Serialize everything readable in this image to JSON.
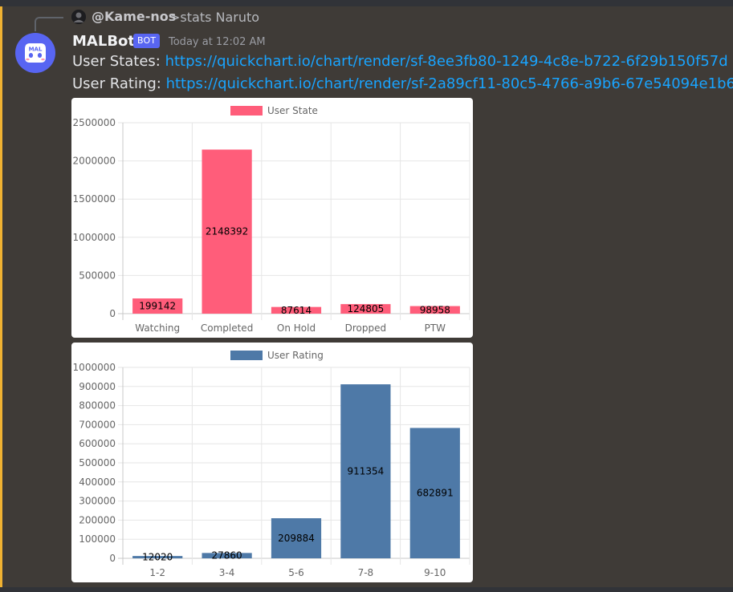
{
  "reply": {
    "author": "@Kame-nos",
    "content": ">stats Naruto"
  },
  "message": {
    "author": "MALBot",
    "badge": "BOT",
    "avatar_text": "MAL",
    "timestamp": "Today at 12:02 AM",
    "line1_label": "User States: ",
    "line1_link": "https://quickchart.io/chart/render/sf-8ee3fb80-1249-4c8e-b722-6f29b150f57d",
    "line2_label": "User Rating: ",
    "line2_link": "https://quickchart.io/chart/render/sf-2a89cf11-80c5-4766-a9b6-67e54094e1b6"
  },
  "colors": {
    "background": "#3f3b37",
    "link": "#19a4ff",
    "badge": "#5865f2",
    "avatar": "#5865f2",
    "accent_bar": "#f0b232",
    "series_state": "#ff5d7a",
    "series_rating": "#4e79a7"
  },
  "chart_data": [
    {
      "type": "bar",
      "legend": "User State",
      "legend_position": "top",
      "categories": [
        "Watching",
        "Completed",
        "On Hold",
        "Dropped",
        "PTW"
      ],
      "values": [
        199142,
        2148392,
        87614,
        124805,
        98958
      ],
      "ylim": [
        0,
        2500000
      ],
      "yticks": [
        0,
        500000,
        1000000,
        1500000,
        2000000,
        2500000
      ],
      "grid": true,
      "color": "#ff5d7a"
    },
    {
      "type": "bar",
      "legend": "User Rating",
      "legend_position": "top",
      "categories": [
        "1-2",
        "3-4",
        "5-6",
        "7-8",
        "9-10"
      ],
      "values": [
        12020,
        27860,
        209884,
        911354,
        682891
      ],
      "ylim": [
        0,
        1000000
      ],
      "yticks": [
        0,
        100000,
        200000,
        300000,
        400000,
        500000,
        600000,
        700000,
        800000,
        900000,
        1000000
      ],
      "grid": true,
      "color": "#4e79a7"
    }
  ]
}
